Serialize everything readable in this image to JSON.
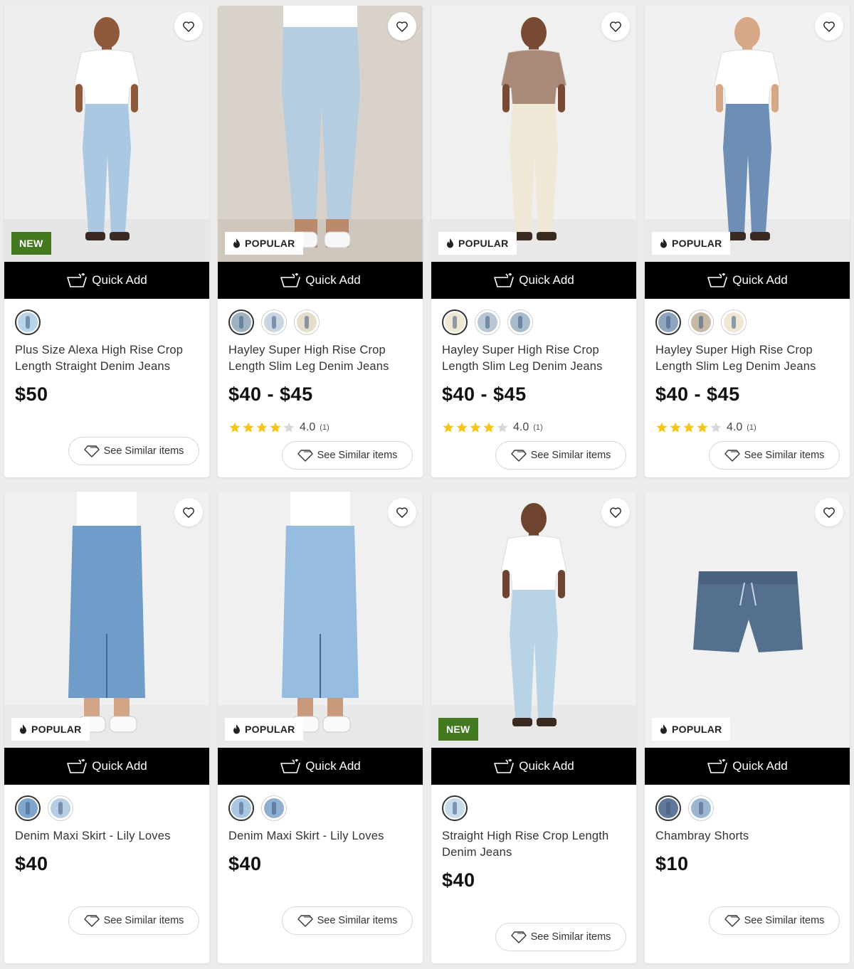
{
  "quick_add_label": "Quick Add",
  "similar_label": "See Similar items",
  "colors": {
    "new_badge": "#447a1f",
    "quick_add_bg": "#000000",
    "star": "#f5c518"
  },
  "products": [
    {
      "title": "Plus Size Alexa High Rise Crop Length Straight Denim Jeans",
      "price": "$50",
      "badge": "NEW",
      "badge_type": "new",
      "image_subject": "woman in light wash cropped jeans",
      "swatches": [
        "#b9d3e8"
      ],
      "rating": null
    },
    {
      "title": "Hayley Super High Rise Crop Length Slim Leg Denim Jeans",
      "price": "$40 - $45",
      "badge": "POPULAR",
      "badge_type": "popular",
      "image_subject": "light wash slim leg jeans",
      "swatches": [
        "#9fb3c2",
        "#c9d6e2",
        "#e6dccc"
      ],
      "rating": {
        "stars": 4,
        "value": "4.0",
        "count": "(1)"
      }
    },
    {
      "title": "Hayley Super High Rise Crop Length Slim Leg Denim Jeans",
      "price": "$40 - $45",
      "badge": "POPULAR",
      "badge_type": "popular",
      "image_subject": "woman in ecru slim leg jeans",
      "swatches": [
        "#efe6d3",
        "#b8c7d3",
        "#a9bccb"
      ],
      "rating": {
        "stars": 4,
        "value": "4.0",
        "count": "(1)"
      }
    },
    {
      "title": "Hayley Super High Rise Crop Length Slim Leg Denim Jeans",
      "price": "$40 - $45",
      "badge": "POPULAR",
      "badge_type": "popular",
      "image_subject": "woman in mid wash slim leg jeans",
      "swatches": [
        "#8fa6bf",
        "#c6b9a6",
        "#efe6d3"
      ],
      "rating": {
        "stars": 4,
        "value": "4.0",
        "count": "(1)"
      }
    },
    {
      "title": "Denim Maxi Skirt - Lily Loves",
      "price": "$40",
      "badge": "POPULAR",
      "badge_type": "popular",
      "image_subject": "mid blue denim maxi skirt",
      "swatches": [
        "#7ea6cf",
        "#b6cde3"
      ],
      "rating": null
    },
    {
      "title": "Denim Maxi Skirt - Lily Loves",
      "price": "$40",
      "badge": "POPULAR",
      "badge_type": "popular",
      "image_subject": "light blue denim maxi skirt",
      "swatches": [
        "#a9c7e2",
        "#8eaed0"
      ],
      "rating": null
    },
    {
      "title": "Straight High Rise Crop Length Denim Jeans",
      "price": "$40",
      "badge": "NEW",
      "badge_type": "new",
      "image_subject": "woman in bleached straight jeans",
      "swatches": [
        "#c7dcea"
      ],
      "rating": null
    },
    {
      "title": "Chambray Shorts",
      "price": "$10",
      "badge": "POPULAR",
      "badge_type": "popular",
      "image_subject": "chambray pull-on shorts",
      "swatches": [
        "#5f7897",
        "#9db6cf"
      ],
      "rating": null
    }
  ]
}
